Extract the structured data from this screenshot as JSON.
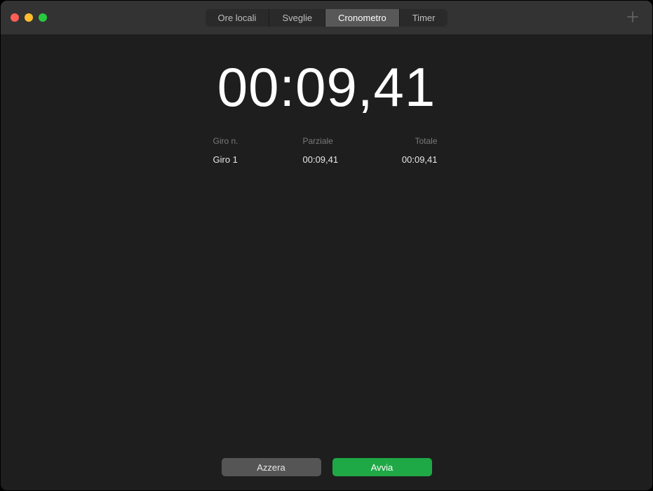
{
  "tabs": {
    "world_clock": "Ore locali",
    "alarms": "Sveglie",
    "stopwatch": "Cronometro",
    "timer": "Timer",
    "active": "stopwatch"
  },
  "stopwatch": {
    "time": "00:09,41",
    "headers": {
      "lap": "Giro n.",
      "split": "Parziale",
      "total": "Totale"
    },
    "laps": [
      {
        "name": "Giro 1",
        "split": "00:09,41",
        "total": "00:09,41"
      }
    ]
  },
  "buttons": {
    "reset": "Azzera",
    "start": "Avvia"
  }
}
